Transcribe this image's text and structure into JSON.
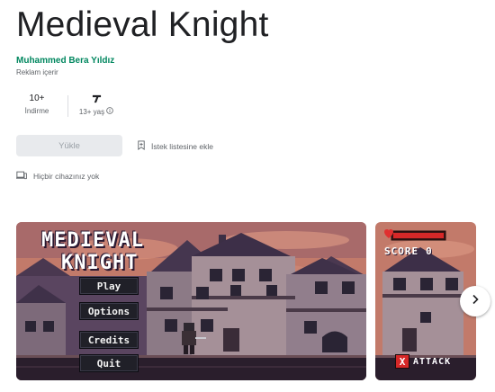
{
  "app": {
    "title": "Medieval Knight",
    "developer": "Muhammed Bera Yıldız",
    "ads_note": "Reklam içerir"
  },
  "stats": {
    "downloads_value": "10+",
    "downloads_label": "İndirme",
    "rating_label": "13+ yaş"
  },
  "actions": {
    "install_label": "Yükle",
    "wishlist_label": "İstek listesine ekle",
    "devices_label": "Hiçbir cihazınız yok"
  },
  "screenshot1": {
    "game_title_line1": "MEDIEVAL",
    "game_title_line2": "KNIGHT",
    "menu": [
      "Play",
      "Options",
      "Credits",
      "Quit"
    ]
  },
  "screenshot2": {
    "score_label": "SCORE",
    "score_value": "0",
    "attack_label": "ATTACK",
    "attack_key": "X"
  },
  "icons": {
    "rating": "age-rating-icon",
    "info": "info-icon",
    "wishlist": "bookmark-add-icon",
    "devices": "devices-icon",
    "next": "chevron-right-icon"
  },
  "colors": {
    "developer": "#01875f",
    "install_bg": "#e8eaed",
    "sky": "#c27a6a"
  }
}
